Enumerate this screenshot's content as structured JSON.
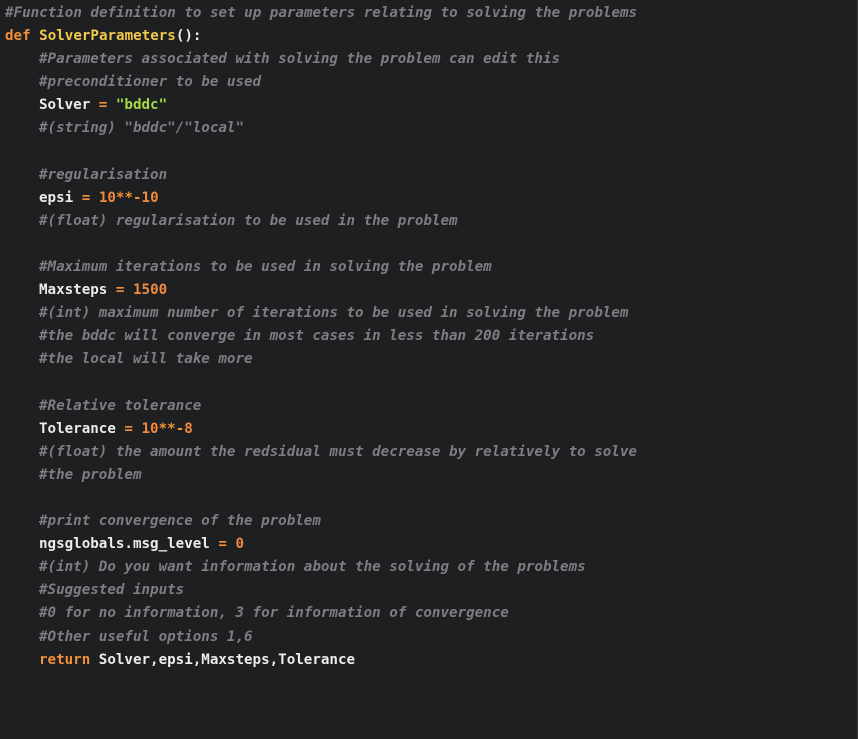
{
  "editor": {
    "background": "#1e1f20",
    "colors": {
      "comment": "#7c7e82",
      "keyword": "#f0903a",
      "function": "#f0c84a",
      "string": "#a6d84a",
      "number": "#f08a3e",
      "text": "#ececec"
    },
    "lines": {
      "l1": "#Function definition to set up parameters relating to solving the problems",
      "l2_kw": "def",
      "l2_fn": "SolverParameters",
      "l2_rest": "():",
      "l3": "#Parameters associated with solving the problem can edit this",
      "l4": "#preconditioner to be used",
      "l5_var": "Solver",
      "l5_op": "=",
      "l5_str": "\"bddc\"",
      "l6": "#(string) \"bddc\"/\"local\"",
      "l8": "#regularisation",
      "l9_var": "epsi",
      "l9_op": "=",
      "l9_num": "10",
      "l9_op2": "**-",
      "l9_num2": "10",
      "l10": "#(float) regularisation to be used in the problem",
      "l12": "#Maximum iterations to be used in solving the problem",
      "l13_var": "Maxsteps",
      "l13_op": "=",
      "l13_num": "1500",
      "l14": "#(int) maximum number of iterations to be used in solving the problem",
      "l15": "#the bddc will converge in most cases in less than 200 iterations",
      "l16": "#the local will take more",
      "l18": "#Relative tolerance",
      "l19_var": "Tolerance",
      "l19_op": "=",
      "l19_num": "10",
      "l19_op2": "**-",
      "l19_num2": "8",
      "l20": "#(float) the amount the redsidual must decrease by relatively to solve",
      "l21": "#the problem",
      "l23": "#print convergence of the problem",
      "l24_var": "ngsglobals.msg_level",
      "l24_op": "=",
      "l24_num": "0",
      "l25": "#(int) Do you want information about the solving of the problems",
      "l26": "#Suggested inputs",
      "l27": "#0 for no information, 3 for information of convergence",
      "l28": "#Other useful options 1,6",
      "l29_kw": "return",
      "l29_rest": "Solver,epsi,Maxsteps,Tolerance"
    }
  }
}
